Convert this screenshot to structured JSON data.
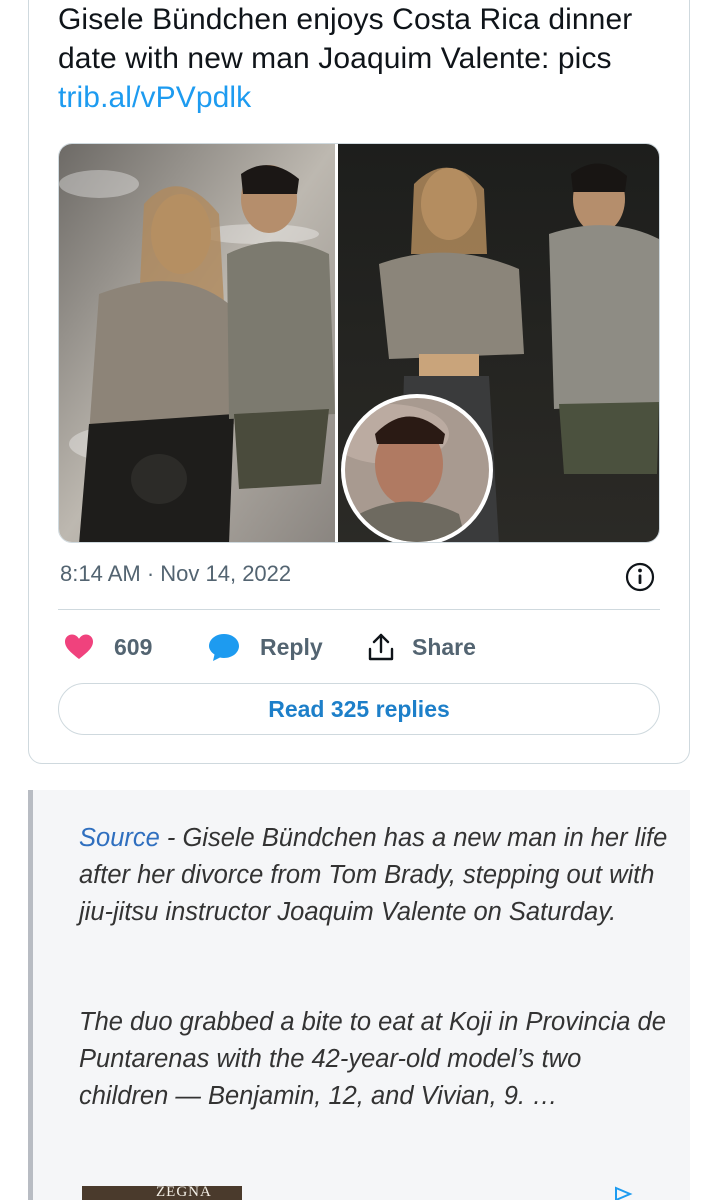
{
  "tweet": {
    "text": "Gisele Bündchen enjoys Costa Rica dinner date with new man Joaquim Valente: pics ",
    "link": "trib.al/vPVpdlk",
    "timestamp": "8:14 AM · Nov 14, 2022",
    "likes": "609",
    "reply_label": "Reply",
    "share_label": "Share",
    "read_replies_label": "Read 325 replies"
  },
  "article": {
    "source_link": "Source",
    "paragraph1_rest": " - Gisele Bündchen has a new man in her life after her divorce from Tom Brady, stepping out with jiu-jitsu instructor Joaquim Valente on Saturday.",
    "paragraph2": "The duo grabbed a bite to eat at Koji in Provincia de Puntarenas with the 42-year-old model’s two children — Benjamin, 12, and Vivian, 9. …"
  },
  "ad": {
    "brand_text": "ZEGNA"
  },
  "colors": {
    "like": "#f0427d",
    "reply": "#1d9bf0",
    "link": "#1d9bf0",
    "source_link": "#2f6fbf"
  }
}
